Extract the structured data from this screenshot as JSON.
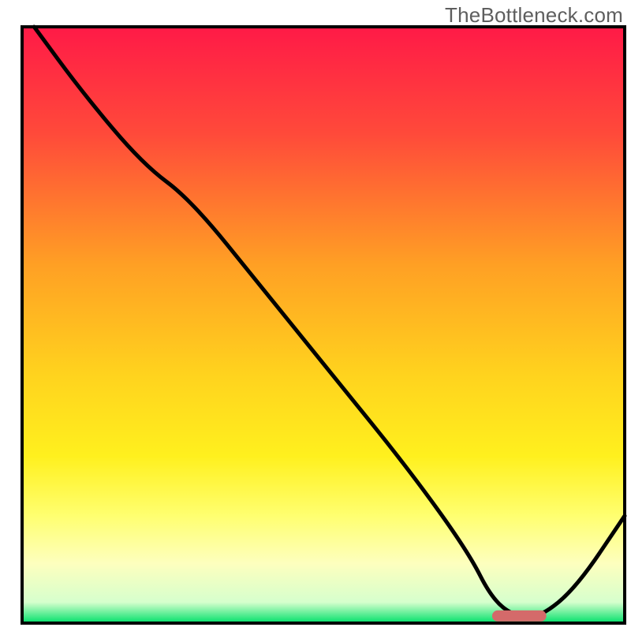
{
  "watermark": "TheBottleneck.com",
  "chart_data": {
    "type": "line",
    "title": "",
    "xlabel": "",
    "ylabel": "",
    "xlim": [
      0,
      100
    ],
    "ylim": [
      0,
      100
    ],
    "grid": false,
    "legend": false,
    "annotations": [],
    "background": {
      "type": "vertical-gradient",
      "description": "red at top through orange, yellow, pale-yellow, to green at bottom",
      "stops": [
        {
          "pos": 0.0,
          "color": "#ff1a47"
        },
        {
          "pos": 0.18,
          "color": "#ff4a3a"
        },
        {
          "pos": 0.4,
          "color": "#ffa024"
        },
        {
          "pos": 0.58,
          "color": "#ffd21e"
        },
        {
          "pos": 0.72,
          "color": "#fff01e"
        },
        {
          "pos": 0.82,
          "color": "#ffff70"
        },
        {
          "pos": 0.9,
          "color": "#fdffbe"
        },
        {
          "pos": 0.965,
          "color": "#d6ffcd"
        },
        {
          "pos": 1.0,
          "color": "#00e06a"
        }
      ]
    },
    "series": [
      {
        "name": "bottleneck-curve",
        "color": "#000000",
        "x": [
          2,
          10,
          20,
          28,
          40,
          52,
          64,
          74,
          78,
          82,
          86,
          92,
          100
        ],
        "y": [
          100,
          89,
          77,
          71,
          56,
          41,
          26,
          12,
          4,
          1,
          1,
          6,
          18
        ]
      }
    ],
    "marker": {
      "name": "optimal-range",
      "shape": "capsule",
      "color": "#d46a6a",
      "x_start": 78,
      "x_end": 87,
      "y": 1.2
    }
  }
}
